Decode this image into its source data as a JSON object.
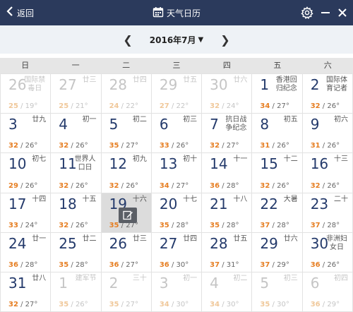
{
  "titlebar": {
    "back_label": "返回",
    "title": "天气日历"
  },
  "nav": {
    "month_label": "2016年7月",
    "dropdown_glyph": "▼",
    "prev_glyph": "❮",
    "next_glyph": "❯"
  },
  "weekdays": [
    "日",
    "一",
    "二",
    "三",
    "四",
    "五",
    "六"
  ],
  "cells": [
    {
      "day": "26",
      "lunar": "国际禁毒日",
      "hi": "25",
      "lo": "19",
      "other": true
    },
    {
      "day": "27",
      "lunar": "廿三",
      "hi": "25",
      "lo": "21",
      "other": true
    },
    {
      "day": "28",
      "lunar": "廿四",
      "hi": "24",
      "lo": "22",
      "other": true
    },
    {
      "day": "29",
      "lunar": "廿五",
      "hi": "27",
      "lo": "22",
      "other": true
    },
    {
      "day": "30",
      "lunar": "廿六",
      "hi": "32",
      "lo": "24",
      "other": true
    },
    {
      "day": "1",
      "lunar": "香港回归纪念",
      "hi": "34",
      "lo": "27",
      "other": false
    },
    {
      "day": "2",
      "lunar": "国际体育记者",
      "hi": "32",
      "lo": "26",
      "other": false
    },
    {
      "day": "3",
      "lunar": "廿九",
      "hi": "32",
      "lo": "26",
      "other": false
    },
    {
      "day": "4",
      "lunar": "初一",
      "hi": "32",
      "lo": "26",
      "other": false
    },
    {
      "day": "5",
      "lunar": "初二",
      "hi": "35",
      "lo": "27",
      "other": false
    },
    {
      "day": "6",
      "lunar": "初三",
      "hi": "33",
      "lo": "26",
      "other": false
    },
    {
      "day": "7",
      "lunar": "抗日战争纪念",
      "hi": "32",
      "lo": "27",
      "other": false
    },
    {
      "day": "8",
      "lunar": "初五",
      "hi": "31",
      "lo": "26",
      "other": false
    },
    {
      "day": "9",
      "lunar": "初六",
      "hi": "31",
      "lo": "26",
      "other": false
    },
    {
      "day": "10",
      "lunar": "初七",
      "hi": "29",
      "lo": "26",
      "other": false
    },
    {
      "day": "11",
      "lunar": "世界人口日",
      "hi": "32",
      "lo": "26",
      "other": false
    },
    {
      "day": "12",
      "lunar": "初九",
      "hi": "32",
      "lo": "26",
      "other": false
    },
    {
      "day": "13",
      "lunar": "初十",
      "hi": "34",
      "lo": "27",
      "other": false
    },
    {
      "day": "14",
      "lunar": "十一",
      "hi": "36",
      "lo": "28",
      "other": false
    },
    {
      "day": "15",
      "lunar": "十二",
      "hi": "32",
      "lo": "26",
      "other": false
    },
    {
      "day": "16",
      "lunar": "十三",
      "hi": "32",
      "lo": "26",
      "other": false
    },
    {
      "day": "17",
      "lunar": "十四",
      "hi": "33",
      "lo": "24",
      "other": false
    },
    {
      "day": "18",
      "lunar": "十五",
      "hi": "32",
      "lo": "26",
      "other": false
    },
    {
      "day": "19",
      "lunar": "十六",
      "hi": "35",
      "lo": "27",
      "other": false,
      "selected": true
    },
    {
      "day": "20",
      "lunar": "十七",
      "hi": "35",
      "lo": "28",
      "other": false
    },
    {
      "day": "21",
      "lunar": "十八",
      "hi": "35",
      "lo": "28",
      "other": false
    },
    {
      "day": "22",
      "lunar": "大暑",
      "hi": "37",
      "lo": "28",
      "other": false
    },
    {
      "day": "23",
      "lunar": "二十",
      "hi": "37",
      "lo": "28",
      "other": false
    },
    {
      "day": "24",
      "lunar": "廿一",
      "hi": "36",
      "lo": "28",
      "other": false
    },
    {
      "day": "25",
      "lunar": "廿二",
      "hi": "35",
      "lo": "28",
      "other": false
    },
    {
      "day": "26",
      "lunar": "廿三",
      "hi": "36",
      "lo": "27",
      "other": false
    },
    {
      "day": "27",
      "lunar": "廿四",
      "hi": "36",
      "lo": "30",
      "other": false
    },
    {
      "day": "28",
      "lunar": "廿五",
      "hi": "37",
      "lo": "31",
      "other": false
    },
    {
      "day": "29",
      "lunar": "廿六",
      "hi": "37",
      "lo": "29",
      "other": false
    },
    {
      "day": "30",
      "lunar": "非洲妇女日",
      "hi": "36",
      "lo": "26",
      "other": false
    },
    {
      "day": "31",
      "lunar": "廿八",
      "hi": "32",
      "lo": "27",
      "other": false
    },
    {
      "day": "1",
      "lunar": "建军节",
      "hi": "35",
      "lo": "26",
      "other": true
    },
    {
      "day": "2",
      "lunar": "三十",
      "hi": "35",
      "lo": "27",
      "other": true
    },
    {
      "day": "3",
      "lunar": "初一",
      "hi": "34",
      "lo": "30",
      "other": true
    },
    {
      "day": "4",
      "lunar": "初二",
      "hi": "34",
      "lo": "30",
      "other": true
    },
    {
      "day": "5",
      "lunar": "初三",
      "hi": "35",
      "lo": "30",
      "other": true
    },
    {
      "day": "6",
      "lunar": "初四",
      "hi": "36",
      "lo": "29",
      "other": true
    }
  ],
  "temp_sep": " / ",
  "temp_unit": "°",
  "colors": {
    "titlebar": "#2b3a5c",
    "day_number": "#243a6b",
    "temp_high": "#e67e22",
    "selected_bg": "#dcdcdc"
  }
}
